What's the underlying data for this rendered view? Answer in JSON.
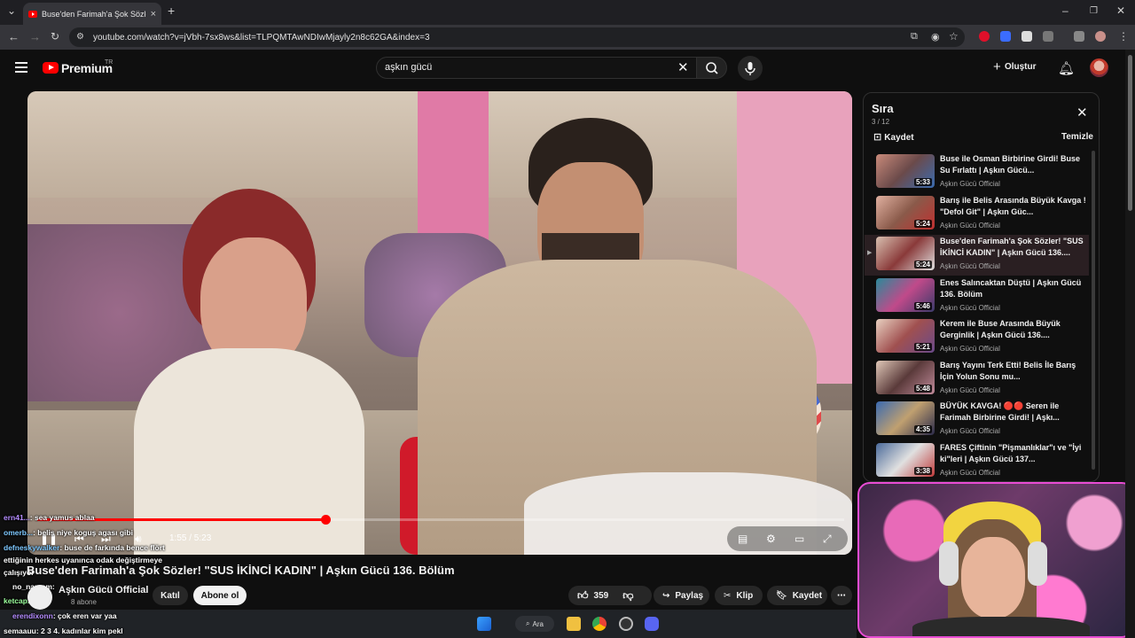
{
  "browser": {
    "tab_title": "Buse'den Farimah'a Şok Sözler...",
    "url": "youtube.com/watch?v=jVbh-7sx8ws&list=TLPQMTAwNDIwMjayly2n8c62GA&index=3"
  },
  "header": {
    "brand": "Premium",
    "region": "TR",
    "search_value": "aşkın gücü",
    "create_label": "Oluştur"
  },
  "player": {
    "time": "1:55 / 5:23",
    "progress_fraction": 0.357
  },
  "chat": [
    {
      "user": "ern41...",
      "msg": ": sea yamus ablaa"
    },
    {
      "user": "omerb...",
      "msg": ": belis niye koguş agası gibi"
    },
    {
      "user": "defneskywalker",
      "msg": ": buse de farkında bence flört"
    },
    {
      "user": "",
      "msg": "ettiğinin herkes uyanınca odak değiştirmeye"
    },
    {
      "user": "",
      "msg": "çalışıyor"
    },
    {
      "user": "no_namem",
      "msg": ":"
    },
    {
      "user": "ketcap...",
      "msg": ":"
    },
    {
      "user": "erendixonn",
      "msg": ": çok eren var yaa"
    },
    {
      "user": "semaauu",
      "msg": ": 2 3 4. kadınlar kim pekl"
    }
  ],
  "video": {
    "title": "Buse'den Farimah'a Şok Sözler! \"SUS İKİNCİ KADIN\" | Aşkın Gücü 136. Bölüm",
    "channel": "Aşkın Gücü Official",
    "subs": "8 abone",
    "join_label": "Katıl",
    "subscribe_label": "Abone ol",
    "likes": "359",
    "share_label": "Paylaş",
    "clip_label": "Klip",
    "save_label": "Kaydet"
  },
  "playlist": {
    "title": "Sıra",
    "count": "3 / 12",
    "save_label": "Kaydet",
    "clear_label": "Temizle",
    "items": [
      {
        "title": "Buse ile Osman Birbirine Girdi! Buse Su Fırlattı | Aşkın Gücü...",
        "channel": "Aşkın Gücü Official",
        "duration": "5:33",
        "active": false
      },
      {
        "title": "Barış ile Belis Arasında Büyük Kavga ! \"Defol Git\" | Aşkın Güc...",
        "channel": "Aşkın Gücü Official",
        "duration": "5:24",
        "active": false
      },
      {
        "title": "Buse'den Farimah'a Şok Sözler! \"SUS İKİNCİ KADIN\" | Aşkın Gücü 136....",
        "channel": "Aşkın Gücü Official",
        "duration": "5:24",
        "active": true
      },
      {
        "title": "Enes Salıncaktan Düştü | Aşkın Gücü 136. Bölüm",
        "channel": "Aşkın Gücü Official",
        "duration": "5:46",
        "active": false
      },
      {
        "title": "Kerem ile Buse Arasında Büyük Gerginlik | Aşkın Gücü 136....",
        "channel": "Aşkın Gücü Official",
        "duration": "5:21",
        "active": false
      },
      {
        "title": "Barış Yayını Terk Etti! Belis İle Barış İçin Yolun Sonu mu...",
        "channel": "Aşkın Gücü Official",
        "duration": "5:48",
        "active": false
      },
      {
        "title": "BÜYÜK KAVGA! 🔴🔴 Seren ile Farimah Birbirine Girdi! | Aşkı...",
        "channel": "Aşkın Gücü Official",
        "duration": "4:35",
        "active": false
      },
      {
        "title": "FARES Çiftinin \"Pişmanlıklar\"ı ve \"İyi ki\"leri | Aşkın Gücü 137...",
        "channel": "Aşkın Gücü Official",
        "duration": "3:38",
        "active": false
      }
    ]
  },
  "taskbar": {
    "search_label": "Ara"
  },
  "colors": {
    "accent": "#ff0000",
    "webcam_border": "#e84cd4"
  }
}
